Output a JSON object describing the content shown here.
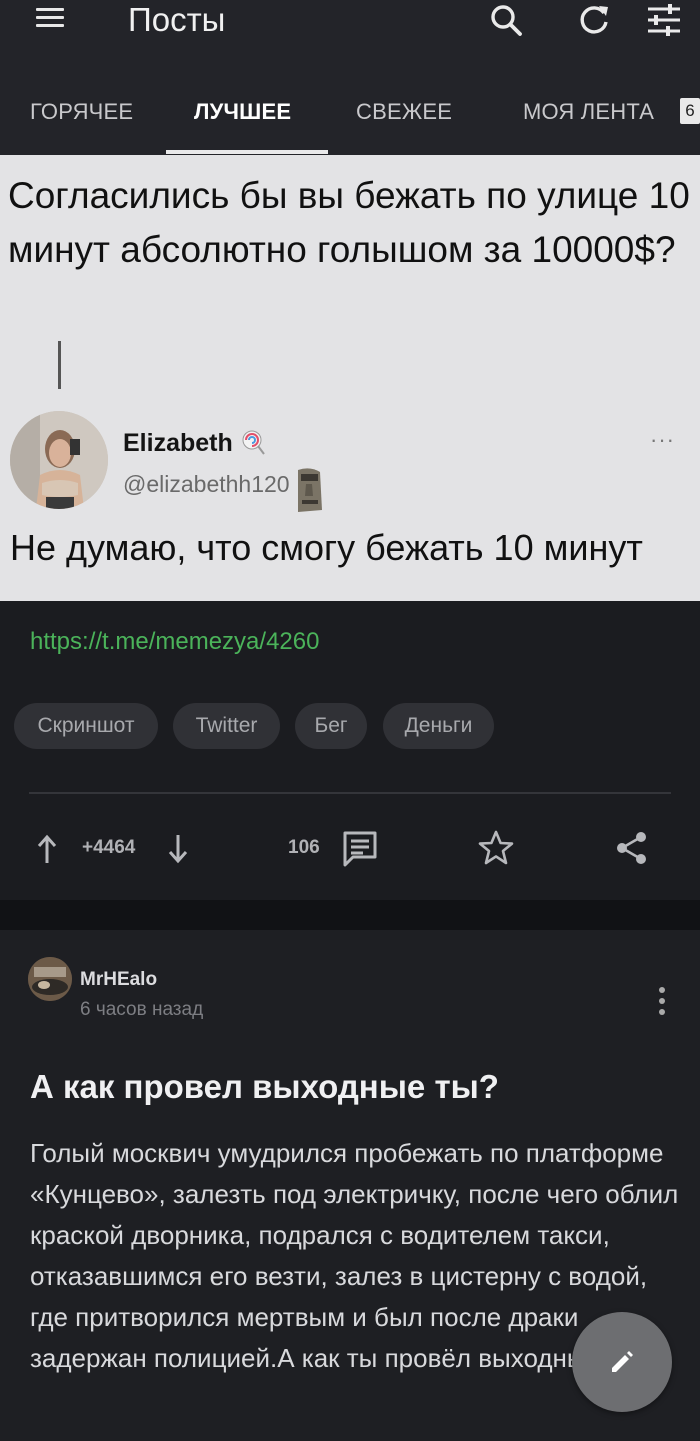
{
  "header": {
    "title": "Посты"
  },
  "tabs": [
    {
      "label": "ГОРЯЧЕЕ"
    },
    {
      "label": "ЛУЧШЕЕ"
    },
    {
      "label": "СВЕЖЕЕ"
    },
    {
      "label": "МОЯ ЛЕНТА"
    }
  ],
  "tab_badge": "6",
  "post1": {
    "image": {
      "question": "Согласились бы вы  бежать по улице 10 минут абсолютно голышом за 10000$?",
      "author_name": "Elizabeth",
      "author_handle": "@elizabethh120",
      "options_glyph": "···",
      "reply": "Не думаю, что смогу бежать 10 минут"
    },
    "link": "https://t.me/memezya/4260",
    "tags": [
      "Скриншот",
      "Twitter",
      "Бег",
      "Деньги"
    ],
    "rating": "+4464",
    "comments": "106"
  },
  "post2": {
    "author": "MrHEalo",
    "time": "6 часов назад",
    "title": "А как провел выходные ты?",
    "text": "Голый москвич умудрился пробежать по платформе «Кунцево», залезть под электричку, после чего облил краской дворника, подрался с водителем такси, отказавшимся его везти, залез в цистерну с водой, где притворился мертвым и был после драки задержан полицией.А как ты провёл выходные?"
  },
  "colors": {
    "background": "#1b1c20",
    "header": "#232429",
    "link": "#4bb35a",
    "tag_bg": "#303136"
  },
  "icons": [
    "menu-icon",
    "search-icon",
    "refresh-icon",
    "filter-icon",
    "upvote-icon",
    "downvote-icon",
    "comment-icon",
    "star-icon",
    "share-icon",
    "more-vertical-icon",
    "pencil-icon"
  ]
}
